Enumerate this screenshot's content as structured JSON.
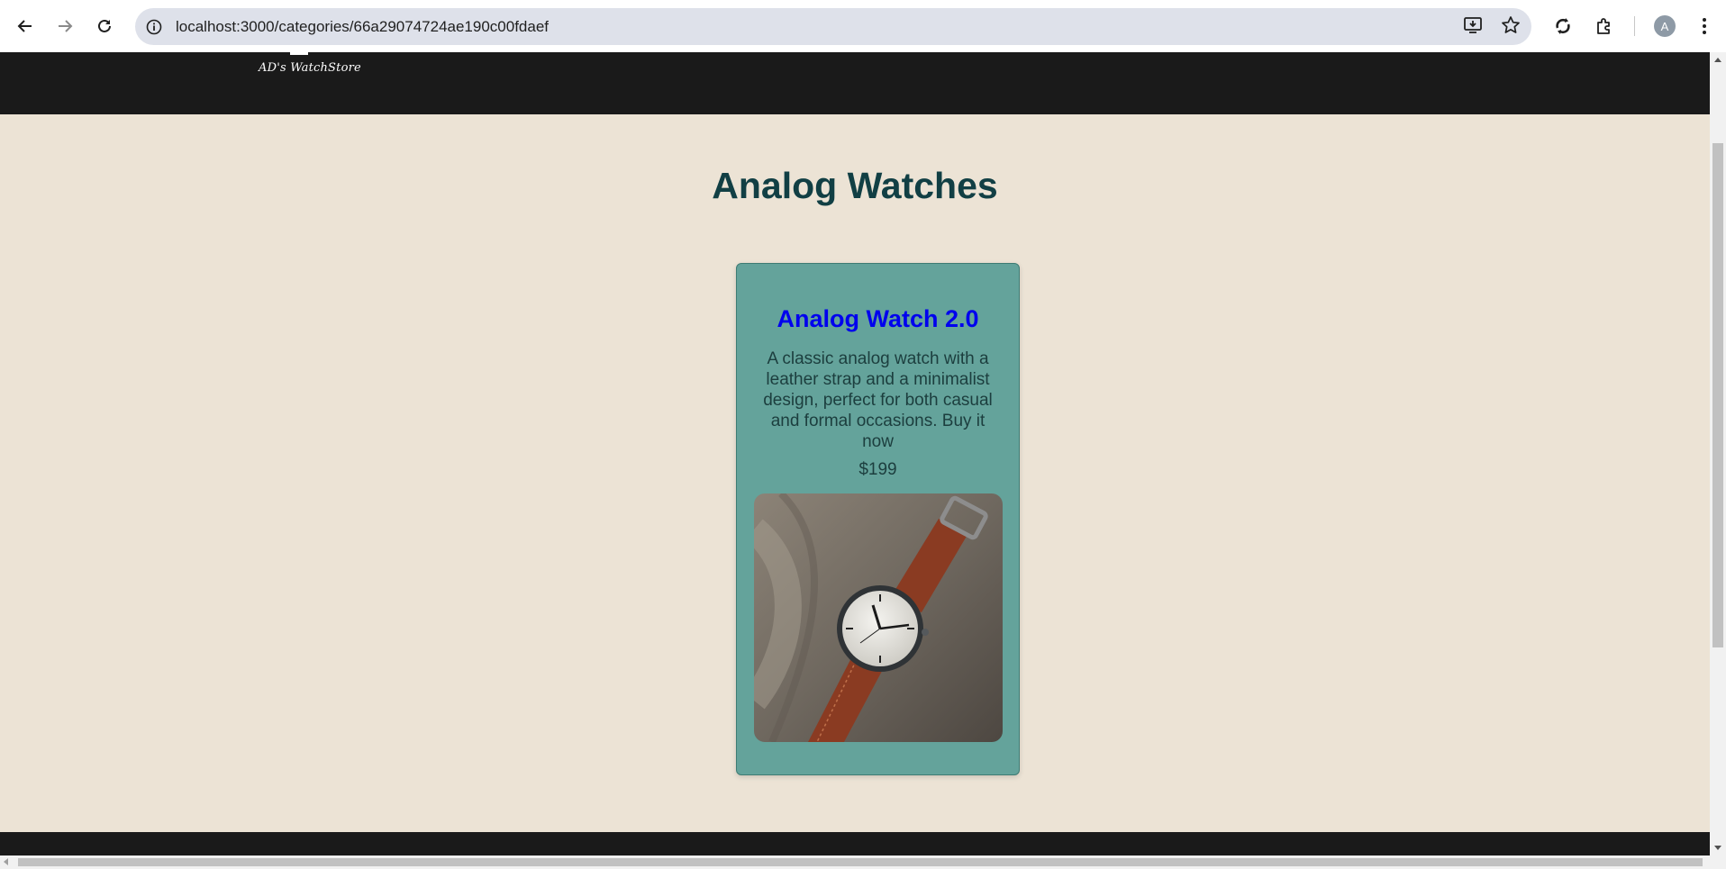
{
  "browser": {
    "url": "localhost:3000/categories/66a29074724ae190c00fdaef",
    "profile_initial": "A",
    "icons": [
      "back-arrow-icon",
      "forward-arrow-icon",
      "reload-icon",
      "site-info-icon",
      "install-app-icon",
      "bookmark-star-icon",
      "sync-icon",
      "extensions-icon",
      "profile-avatar",
      "more-menu-icon"
    ]
  },
  "header": {
    "logo_text": "AD's WatchStore"
  },
  "main": {
    "title": "Analog Watches",
    "products": [
      {
        "name": "Analog Watch 2.0",
        "description": "A classic analog watch with a leather strap and a minimalist design, perfect for both casual and formal occasions. Buy it now",
        "price": "$199",
        "image": "analog-watch-photo"
      }
    ]
  },
  "colors": {
    "header_bg": "#1a1a1a",
    "page_bg": "#ece3d5",
    "card_bg": "#64a39b",
    "title_color": "#113f44",
    "link_color": "#0000ee"
  }
}
